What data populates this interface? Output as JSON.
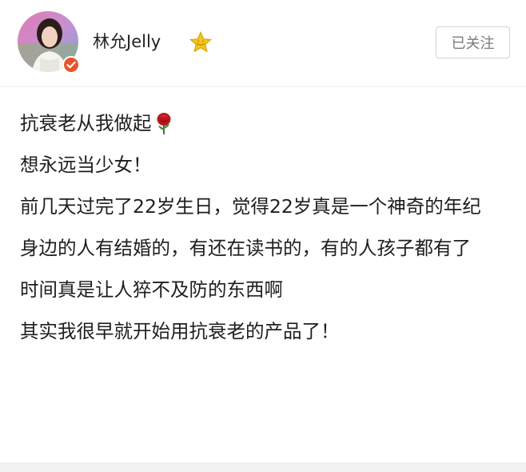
{
  "header": {
    "username": "林允Jelly",
    "follow_label": "已关注"
  },
  "post": {
    "paragraphs": [
      "抗衰老从我做起",
      "想永远当少女！",
      "前几天过完了22岁生日，觉得22岁真是一个神奇的年纪",
      "身边的人有结婚的，有还在读书的，有的人孩子都有了",
      "时间真是让人猝不及防的东西啊",
      "其实我很早就开始用抗衰老的产品了！"
    ]
  },
  "icons": {
    "avatar": "avatar",
    "verified": "verified-badge-icon",
    "star": "star-icon",
    "rose": "rose-icon"
  },
  "colors": {
    "verified": "#e8542b",
    "star": "#f5c518",
    "follow_text": "#7a7a7a",
    "rose": "#b8161c"
  }
}
